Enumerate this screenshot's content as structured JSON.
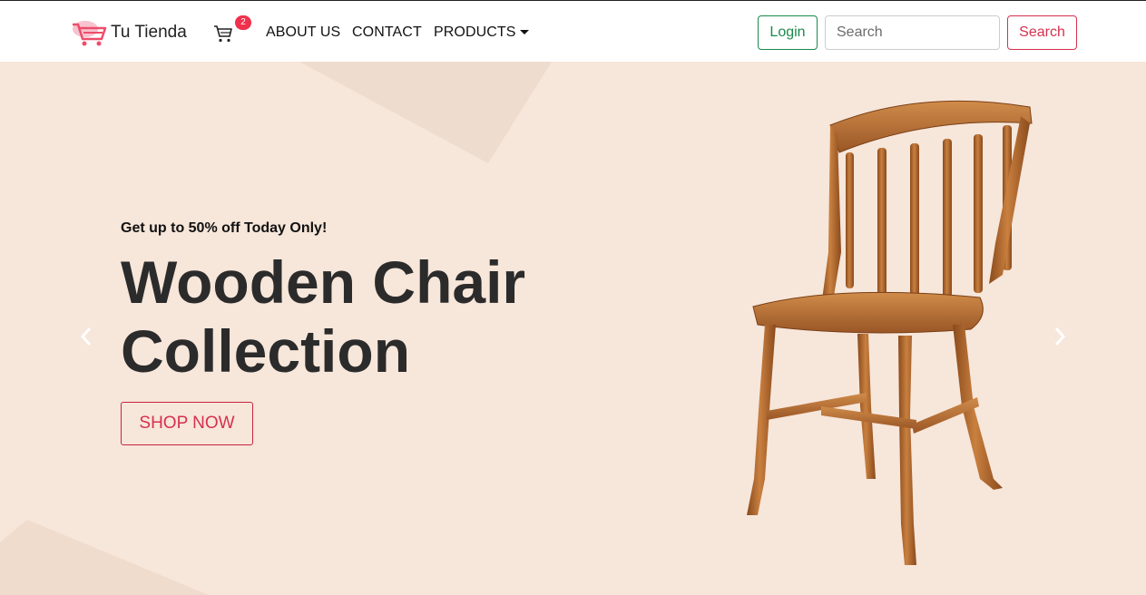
{
  "brand": {
    "name": "Tu Tienda",
    "logo_icon": "shopping-cart-logo-icon"
  },
  "cart": {
    "icon": "cart-icon",
    "count": "2"
  },
  "nav": {
    "about_label": "ABOUT US",
    "contact_label": "CONTACT",
    "products_label": "PRODUCTS"
  },
  "auth": {
    "login_label": "Login"
  },
  "search": {
    "placeholder": "Search",
    "value": "",
    "button_label": "Search"
  },
  "hero": {
    "promo_text": "Get up to 50% off Today Only!",
    "headline": "Wooden Chair Collection",
    "cta_label": "SHOP NOW",
    "image_icon": "wooden-chair-image",
    "background_color": "#f7e6da"
  },
  "carousel": {
    "prev_icon": "chevron-left-icon",
    "next_icon": "chevron-right-icon"
  },
  "colors": {
    "accent": "#d6314e",
    "login": "#1a8a4a",
    "badge": "#f0304c"
  }
}
